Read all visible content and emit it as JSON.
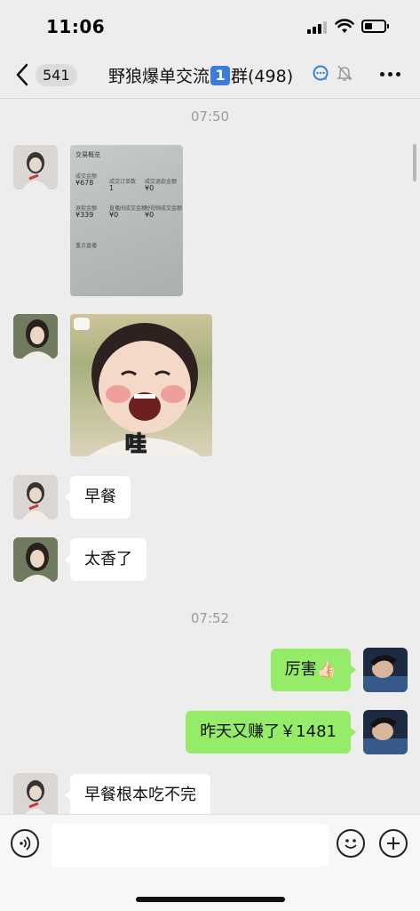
{
  "status_bar": {
    "time": "11:06"
  },
  "nav": {
    "unread_count": "541",
    "title_prefix": "野狼爆单交流",
    "title_keycap": "1",
    "title_suffix": "群(498)",
    "icons": [
      "back-chevron-icon",
      "chat-bubble-icon",
      "mute-bell-icon",
      "more-icon"
    ]
  },
  "messages": [
    {
      "type": "timestamp",
      "text": "07:50"
    },
    {
      "type": "image",
      "side": "left",
      "content": "screenshot",
      "screenshot_text": {
        "header": "交易概览",
        "labels": [
          "成交金额",
          "成交订单数",
          "成交退款金额",
          "退款金额",
          "直播间成交金额",
          "短视频成交金额"
        ],
        "values": [
          "¥678",
          "1",
          "¥0",
          "¥339",
          "¥0",
          "¥0"
        ],
        "footer": "重点直播"
      }
    },
    {
      "type": "image",
      "side": "left",
      "content": "sticker",
      "caption": "哇"
    },
    {
      "type": "text",
      "side": "left",
      "text": "早餐"
    },
    {
      "type": "text",
      "side": "left",
      "text": "太香了"
    },
    {
      "type": "timestamp",
      "text": "07:52"
    },
    {
      "type": "text",
      "side": "right",
      "text": "厉害👍🏻"
    },
    {
      "type": "text",
      "side": "right",
      "text": "昨天又赚了￥1481"
    },
    {
      "type": "text",
      "side": "left",
      "text": "早餐根本吃不完"
    }
  ],
  "input_bar": {
    "placeholder": "",
    "icons": [
      "voice-icon",
      "emoji-icon",
      "plus-icon"
    ]
  },
  "colors": {
    "background": "#ededed",
    "incoming_bubble": "#ffffff",
    "outgoing_bubble": "#95ec69",
    "keycap": "#3b7ddd"
  }
}
